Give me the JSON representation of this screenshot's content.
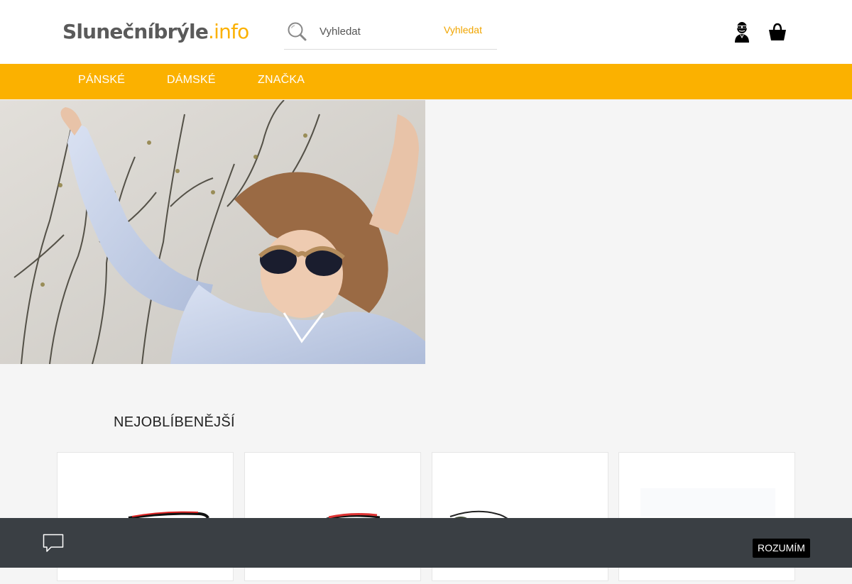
{
  "header": {
    "logo_main": "Slunečníbrýle",
    "logo_tld": ".info",
    "search_placeholder": "Vyhledat",
    "search_button": "Vyhledat"
  },
  "nav": {
    "items": [
      {
        "label": "PÁNSKÉ"
      },
      {
        "label": "DÁMSKÉ"
      },
      {
        "label": "ZNAČKA"
      }
    ]
  },
  "hero": {
    "image": "woman-wearing-sunglasses-photo"
  },
  "section": {
    "title": "NEJOBLÍBENĚJŠÍ",
    "products": [
      {
        "image": "sport-sunglasses-black-red"
      },
      {
        "image": "sport-sunglasses-red"
      },
      {
        "image": "aviator-sunglasses-green"
      },
      {
        "image": "product-image"
      }
    ]
  },
  "cookie_bar": {
    "accept_label": "ROZUMÍM"
  },
  "colors": {
    "accent": "#fbb100",
    "header_bg": "#ffffff",
    "page_bg": "#f5f5f5",
    "cookie_bg": "#3a3f44"
  }
}
